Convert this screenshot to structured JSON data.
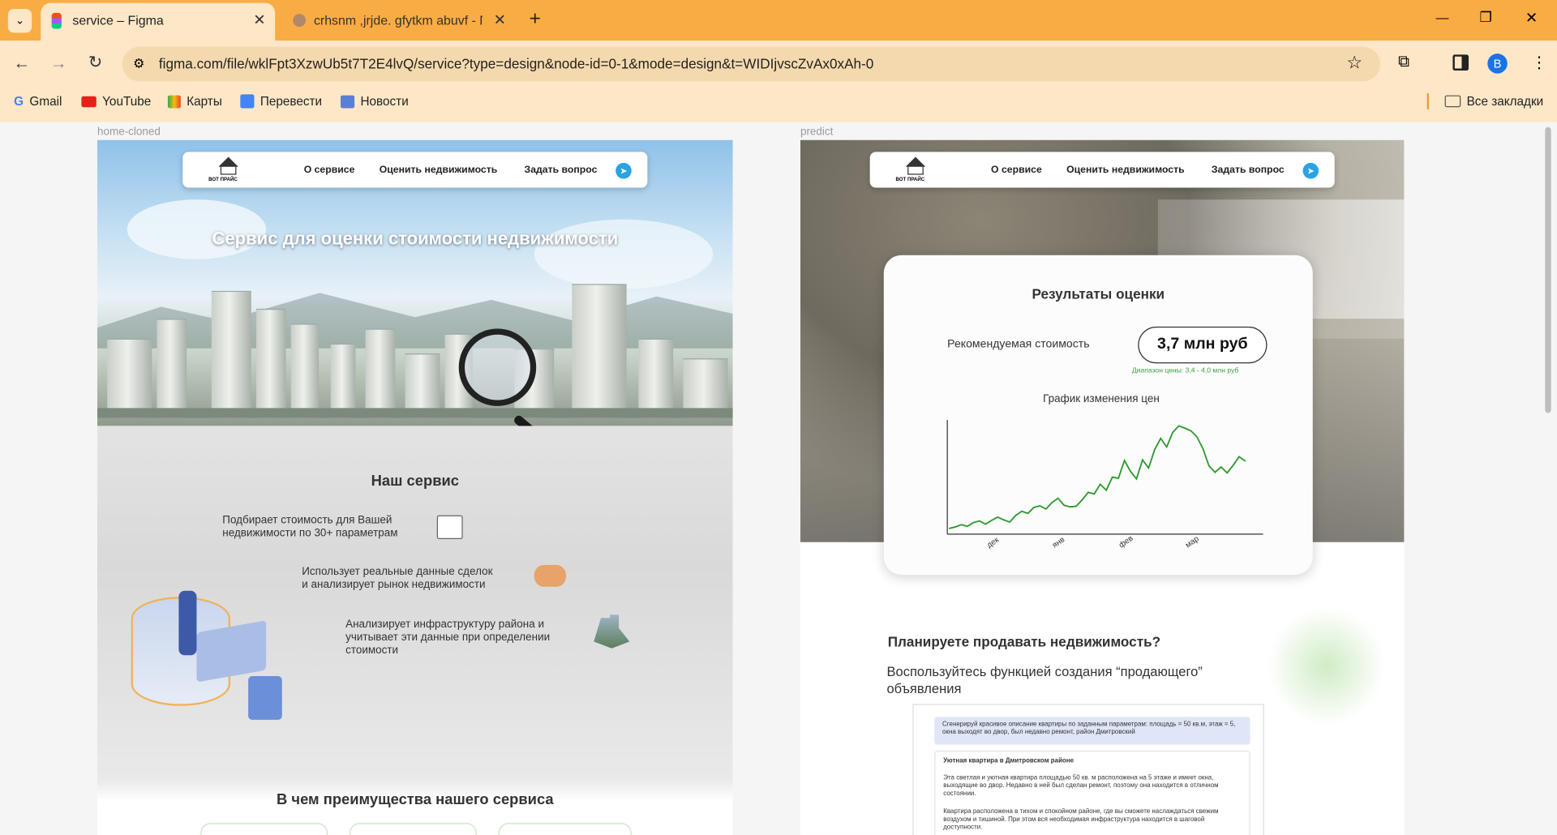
{
  "browser": {
    "tabs": [
      {
        "title": "service – Figma",
        "active": true
      },
      {
        "title": "crhsnm ,jrjde. gfytkm abuvf - П…",
        "active": false
      }
    ],
    "new_tab_symbol": "+",
    "url": "figma.com/file/wklFpt3XzwUb5t7T2E4lvQ/service?type=design&node-id=0-1&mode=design&t=WIDIjvscZvAx0xAh-0",
    "profile_initial": "B",
    "bookmarks": [
      "Gmail",
      "YouTube",
      "Карты",
      "Перевести",
      "Новости"
    ],
    "all_bookmarks": "Все закладки",
    "window_controls": {
      "minimize": "—",
      "restore": "❐",
      "close": "✕"
    }
  },
  "canvas": {
    "left_frame_label": "home-cloned",
    "right_frame_label": "predict",
    "nav": {
      "logo_text": "ВОТ ПРАЙС",
      "links": [
        "О сервисе",
        "Оценить недвижимость",
        "Задать вопрос"
      ]
    },
    "home": {
      "hero_title": "Сервис для оценки стоимости недвижимости",
      "service_heading": "Наш сервис",
      "features": [
        "Подбирает стоимость для Вашей\nнедвижимости по 30+ параметрам",
        "Использует реальные данные сделок\nи анализирует рынок недвижимости",
        "Анализирует инфраструктуру района и\nучитывает эти данные при определении\nстоимости"
      ],
      "advantages_heading": "В чем преимущества нашего сервиса"
    },
    "predict": {
      "results_title": "Результаты оценки",
      "recommended_label": "Рекомендуемая стоимость",
      "price": "3,7 млн руб",
      "price_range": "Диапазон цены: 3,4 - 4,0 млн руб",
      "chart_title": "График изменения цен",
      "sell_heading": "Планируете продавать недвижимость?",
      "sell_sub": "Воспользуйтесь функцией создания “продающего”\nобъявления",
      "prompt_text": "Сгенерируй красивое описание квартиры по заданным параметрам: площадь = 50 кв.м, этаж = 5, окна выходят во двор, был недавно ремонт, район Дмитровский",
      "answer_title": "Уютная квартира в Дмитровском районе",
      "answer_p1": "Эта светлая и уютная квартира площадью 50 кв. м расположена на 5 этаже и имеет окна, выходящие во двор. Недавно в ней был сделан ремонт, поэтому она находится в отличном состоянии.",
      "answer_p2": "Квартира расположена в тихом и спокойном районе, где вы сможете наслаждаться свежим воздухом и тишиной. При этом вся необходимая инфраструктура находится в шаговой доступности."
    }
  },
  "chart_data": {
    "type": "line",
    "title": "График изменения цен",
    "x_tick_labels": [
      "дек",
      "янв",
      "фев",
      "мар"
    ],
    "values": [
      0.5,
      0.8,
      1.2,
      0.9,
      1.6,
      1.9,
      1.3,
      2.0,
      2.6,
      2.1,
      1.7,
      2.9,
      3.7,
      3.3,
      4.4,
      4.7,
      4.1,
      5.3,
      6.1,
      4.8,
      4.5,
      4.6,
      5.8,
      7.2,
      6.9,
      8.7,
      7.6,
      10.0,
      9.8,
      13.1,
      11.1,
      9.7,
      13.2,
      11.7,
      15.1,
      17.2,
      15.6,
      18.3,
      19.5,
      19.1,
      18.6,
      17.5,
      15.3,
      12.1,
      10.9,
      11.9,
      10.8,
      12.2,
      13.8,
      13.0
    ],
    "line_color": "#2e9a2e",
    "grid": false
  }
}
